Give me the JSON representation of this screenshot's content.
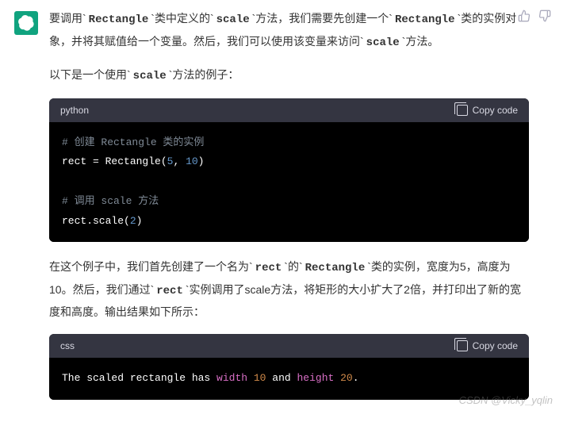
{
  "feedback": {
    "up": "👍",
    "down": "👎"
  },
  "para1": {
    "t1": "要调用`",
    "c1": "Rectangle",
    "t2": "`类中定义的`",
    "c2": "scale",
    "t3": "`方法，我们需要先创建一个`",
    "c3": "Rectangle",
    "t4": "`类的实例对象，并将其赋值给一个变量。然后，我们可以使用该变量来访问`",
    "c4": "scale",
    "t5": "`方法。"
  },
  "para2": {
    "t1": "以下是一个使用`",
    "c1": "scale",
    "t2": "`方法的例子："
  },
  "codeblock1": {
    "lang": "python",
    "copy": "Copy code",
    "line1_comment": "# 创建 Rectangle 类的实例",
    "line2_a": "rect = ",
    "line2_b": "Rectangle",
    "line2_c": "(",
    "line2_n1": "5",
    "line2_d": ", ",
    "line2_n2": "10",
    "line2_e": ")",
    "line3_comment": "# 调用 scale 方法",
    "line4_a": "rect.scale(",
    "line4_n": "2",
    "line4_b": ")"
  },
  "para3": {
    "t1": "在这个例子中，我们首先创建了一个名为`",
    "c1": "rect",
    "t2": "`的`",
    "c2": "Rectangle",
    "t3": "`类的实例，宽度为5，高度为10。然后，我们通过`",
    "c3": "rect",
    "t4": "`实例调用了scale方法，将矩形的大小扩大了2倍，并打印出了新的宽度和高度。输出结果如下所示："
  },
  "codeblock2": {
    "lang": "css",
    "copy": "Copy code",
    "l_a": "The scaled rectangle has ",
    "l_b": "width",
    "l_c": " ",
    "l_n1": "10",
    "l_d": " and ",
    "l_e": "height",
    "l_f": " ",
    "l_n2": "20",
    "l_g": "."
  },
  "watermark": "CSDN @Vicky_yqlin"
}
